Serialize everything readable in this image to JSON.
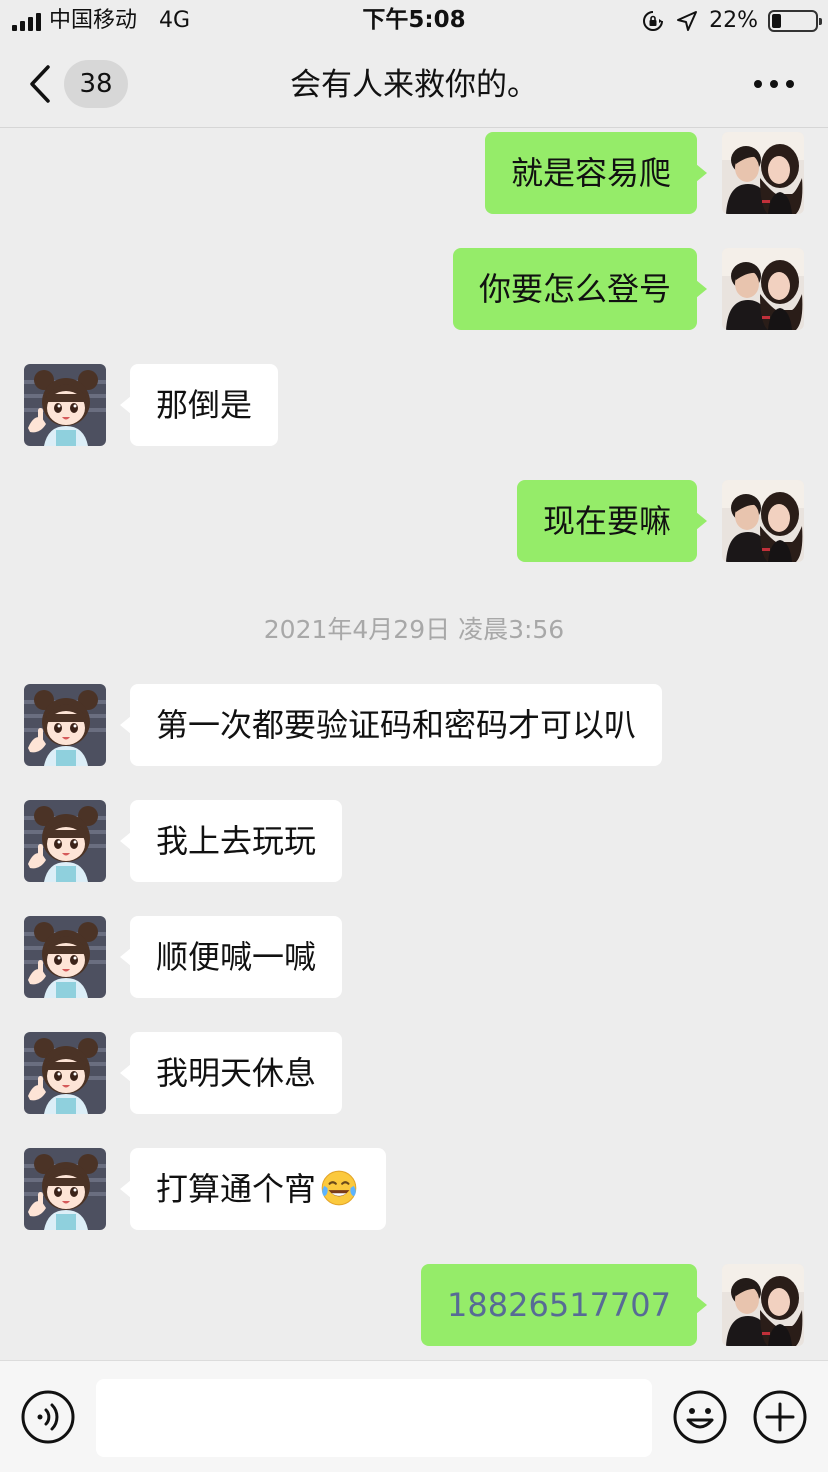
{
  "status_bar": {
    "carrier": "中国移动",
    "network": "4G",
    "time": "下午5:08",
    "battery_percent_label": "22%",
    "battery_level": 0.22
  },
  "nav": {
    "unread_count": "38",
    "title": "会有人来救你的。"
  },
  "messages": [
    {
      "direction": "out",
      "text": "就是容易爬"
    },
    {
      "direction": "out",
      "text": "你要怎么登号"
    },
    {
      "direction": "in",
      "text": "那倒是"
    },
    {
      "direction": "out",
      "text": "现在要嘛"
    },
    {
      "timestamp": "2021年4月29日 凌晨3:56"
    },
    {
      "direction": "in",
      "text": "第一次都要验证码和密码才可以叭"
    },
    {
      "direction": "in",
      "text": "我上去玩玩"
    },
    {
      "direction": "in",
      "text": "顺便喊一喊"
    },
    {
      "direction": "in",
      "text": "我明天休息"
    },
    {
      "direction": "in",
      "text": "打算通个宵",
      "emoji": "face-with-tears-of-joy"
    },
    {
      "direction": "out",
      "text": "18826517707",
      "link": true
    }
  ],
  "input": {
    "value": ""
  },
  "icons": {
    "back": "chevron-left-icon",
    "more": "more-dots-icon",
    "voice": "voice-icon",
    "emoji": "smiley-icon",
    "plus": "plus-icon"
  },
  "colors": {
    "outgoing_bubble": "#95ec69",
    "incoming_bubble": "#ffffff",
    "background": "#ededed",
    "link_text": "#576b95"
  }
}
